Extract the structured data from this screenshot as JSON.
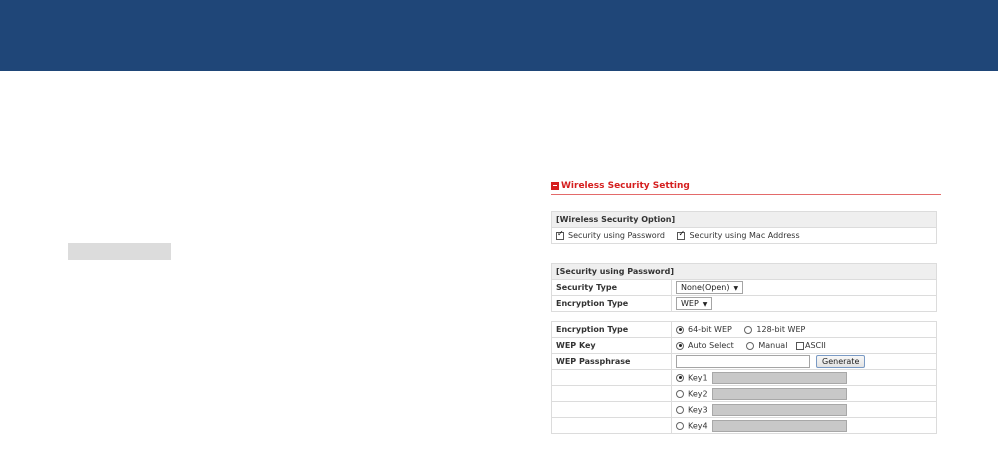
{
  "page": {
    "section_title": "Wireless Security Setting"
  },
  "security_option": {
    "header": "[Wireless Security Option]",
    "password_label": "Security using Password",
    "password_checked": true,
    "mac_label": "Security using Mac Address",
    "mac_checked": true
  },
  "password_section": {
    "header": "[Security using Password]",
    "security_type_label": "Security Type",
    "security_type_value": "None(Open)",
    "encryption_type_label": "Encryption Type",
    "encryption_type_value": "WEP"
  },
  "wep_section": {
    "encryption_label": "Encryption Type",
    "opt_64": "64-bit WEP",
    "opt_128": "128-bit WEP",
    "selected_bits": "64-bit WEP",
    "wep_key_label": "WEP Key",
    "auto_select": "Auto Select",
    "manual": "Manual",
    "ascii": "ASCII",
    "key_mode": "Auto Select",
    "passphrase_label": "WEP Passphrase",
    "passphrase_value": "",
    "generate_label": "Generate",
    "keys": [
      "Key1",
      "Key2",
      "Key3",
      "Key4"
    ],
    "selected_key": "Key1"
  },
  "colors": {
    "header_bar": "#1f4678",
    "accent_red": "#d51f1f",
    "row_header_bg": "#efefef"
  }
}
